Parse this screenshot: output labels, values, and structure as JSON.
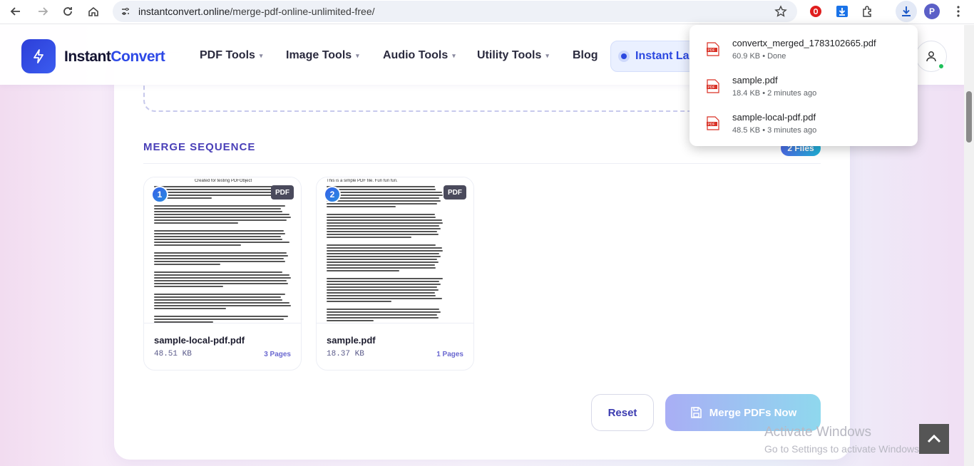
{
  "browser": {
    "url_host": "instantconvert.online",
    "url_path": "/merge-pdf-online-unlimited-free/",
    "profile_initial": "P"
  },
  "header": {
    "logo_main": "Instant",
    "logo_accent": "Convert",
    "nav": [
      {
        "label": "PDF Tools"
      },
      {
        "label": "Image Tools"
      },
      {
        "label": "Audio Tools"
      },
      {
        "label": "Utility Tools"
      },
      {
        "label": "Blog"
      }
    ],
    "lab_label": "Instant Lab"
  },
  "merge": {
    "title": "MERGE SEQUENCE",
    "files_badge": "2 Files",
    "files": [
      {
        "index": "1",
        "tag": "PDF",
        "name": "sample-local-pdf.pdf",
        "size": "48.51 KB",
        "pages": "3 Pages",
        "thumb_heading": "Created for testing PDFObject"
      },
      {
        "index": "2",
        "tag": "PDF",
        "name": "sample.pdf",
        "size": "18.37 KB",
        "pages": "1 Pages",
        "thumb_heading": "This is a simple PDF file. Fun fun fun."
      }
    ],
    "reset_label": "Reset",
    "merge_label": "Merge PDFs Now"
  },
  "downloads": [
    {
      "name": "convertx_merged_1783102665.pdf",
      "meta": "60.9 KB • Done"
    },
    {
      "name": "sample.pdf",
      "meta": "18.4 KB • 2 minutes ago"
    },
    {
      "name": "sample-local-pdf.pdf",
      "meta": "48.5 KB • 3 minutes ago"
    }
  ],
  "windows_activation": {
    "line1": "Activate Windows",
    "line2": "Go to Settings to activate Windows."
  },
  "colors": {
    "brand": "#2d49e6",
    "accent_purple": "#4a40b8",
    "online": "#1fbf5a"
  }
}
